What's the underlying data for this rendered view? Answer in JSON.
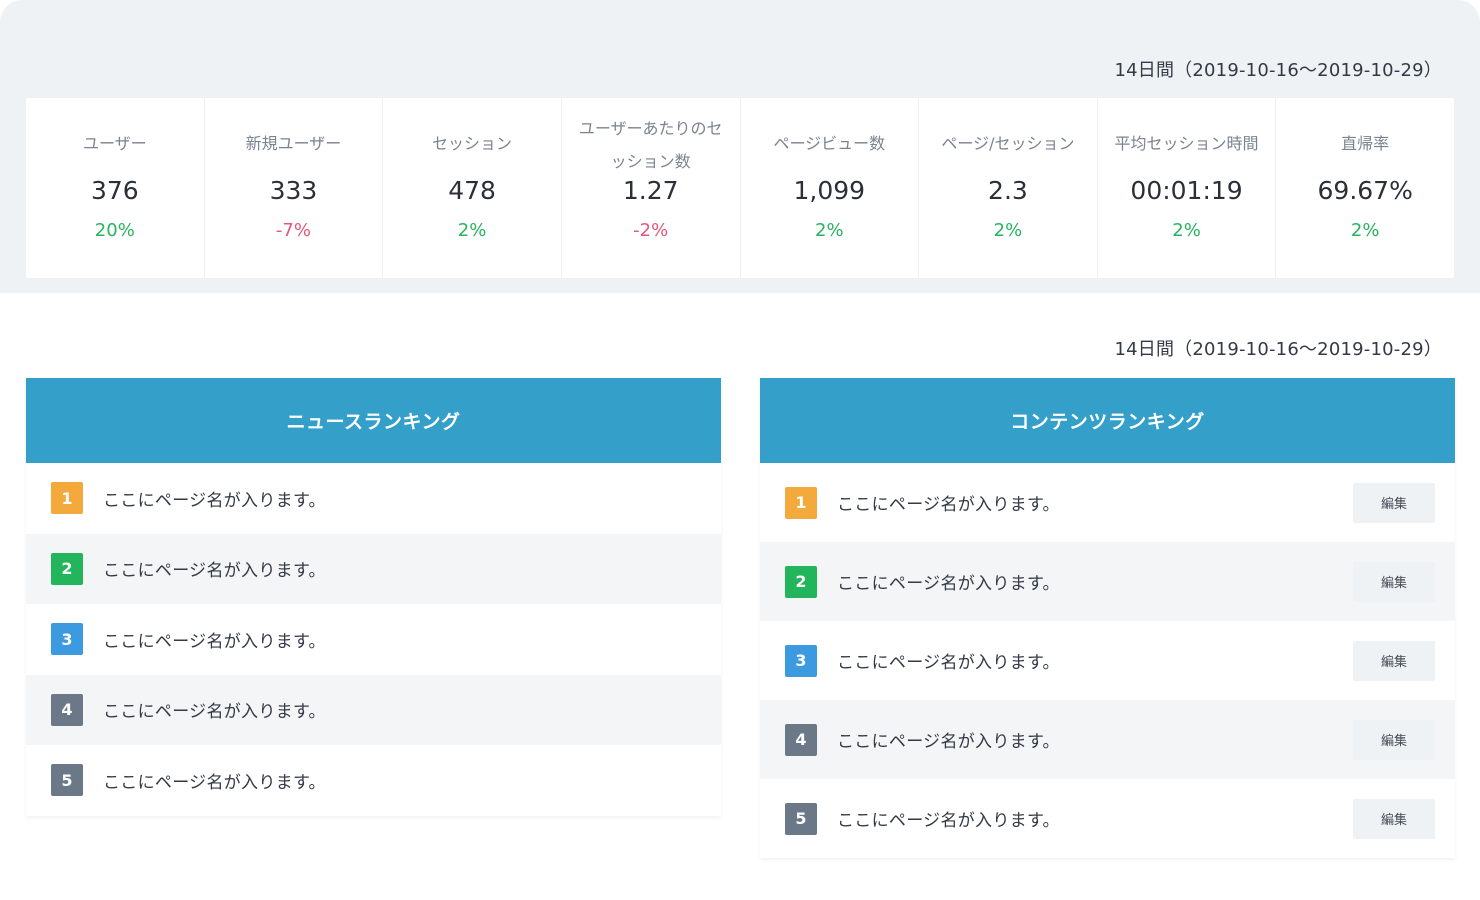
{
  "period_label": "14日間（2019-10-16〜2019-10-29）",
  "colors": {
    "positive": "#27b35f",
    "negative": "#e5577a",
    "header": "#349fc9",
    "rank1": "#f3a93b",
    "rank2": "#22b55b",
    "rank3": "#3c9be0",
    "rank4": "#6a7888",
    "rank5": "#6a7888"
  },
  "stats": [
    {
      "label": "ユーザー",
      "value": "376",
      "change": "20%",
      "trend": "pos"
    },
    {
      "label": "新規ユーザー",
      "value": "333",
      "change": "-7%",
      "trend": "neg"
    },
    {
      "label": "セッション",
      "value": "478",
      "change": "2%",
      "trend": "pos"
    },
    {
      "label": "ユーザーあたりのセッション数",
      "value": "1.27",
      "change": "-2%",
      "trend": "neg"
    },
    {
      "label": "ページビュー数",
      "value": "1,099",
      "change": "2%",
      "trend": "pos"
    },
    {
      "label": "ページ/セッション",
      "value": "2.3",
      "change": "2%",
      "trend": "pos"
    },
    {
      "label": "平均セッション時間",
      "value": "00:01:19",
      "change": "2%",
      "trend": "pos"
    },
    {
      "label": "直帰率",
      "value": "69.67%",
      "change": "2%",
      "trend": "pos"
    }
  ],
  "news_ranking": {
    "title": "ニュースランキング",
    "items": [
      {
        "rank": "1",
        "text": "ここにページ名が入ります。"
      },
      {
        "rank": "2",
        "text": "ここにページ名が入ります。"
      },
      {
        "rank": "3",
        "text": "ここにページ名が入ります。"
      },
      {
        "rank": "4",
        "text": "ここにページ名が入ります。"
      },
      {
        "rank": "5",
        "text": "ここにページ名が入ります。"
      }
    ]
  },
  "content_ranking": {
    "title": "コンテンツランキング",
    "edit_label": "編集",
    "items": [
      {
        "rank": "1",
        "text": "ここにページ名が入ります。"
      },
      {
        "rank": "2",
        "text": "ここにページ名が入ります。"
      },
      {
        "rank": "3",
        "text": "ここにページ名が入ります。"
      },
      {
        "rank": "4",
        "text": "ここにページ名が入ります。"
      },
      {
        "rank": "5",
        "text": "ここにページ名が入ります。"
      }
    ]
  }
}
